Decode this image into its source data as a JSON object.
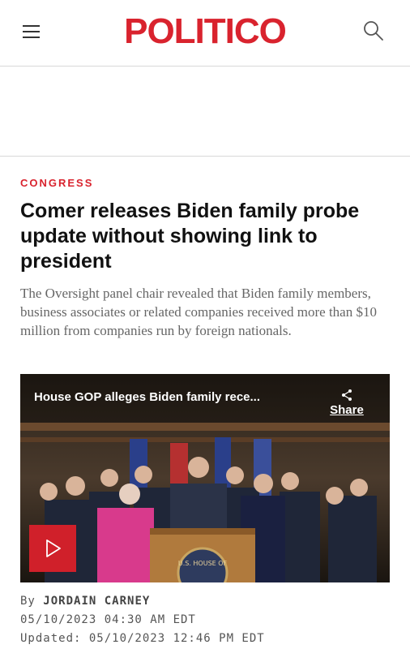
{
  "header": {
    "logo": "POLITICO",
    "menu_icon": "hamburger-menu-icon",
    "search_icon": "search-icon",
    "brand_color": "#d9232e"
  },
  "article": {
    "section": "CONGRESS",
    "headline": "Comer releases Biden family probe update without showing link to president",
    "dek": "The Oversight panel chair revealed that Biden family members, business associates or related companies received more than $10 million from companies run by foreign nationals.",
    "byline_prefix": "By",
    "author": "JORDAIN CARNEY",
    "published": "05/10/2023 04:30 AM EDT",
    "updated": "Updated: 05/10/2023 12:46 PM EDT"
  },
  "video": {
    "title": "House GOP alleges Biden family rece...",
    "share_label": "Share",
    "share_icon": "share-icon",
    "play_icon": "play-icon",
    "podium_seal_text": "U.S. HOUSE OF"
  }
}
